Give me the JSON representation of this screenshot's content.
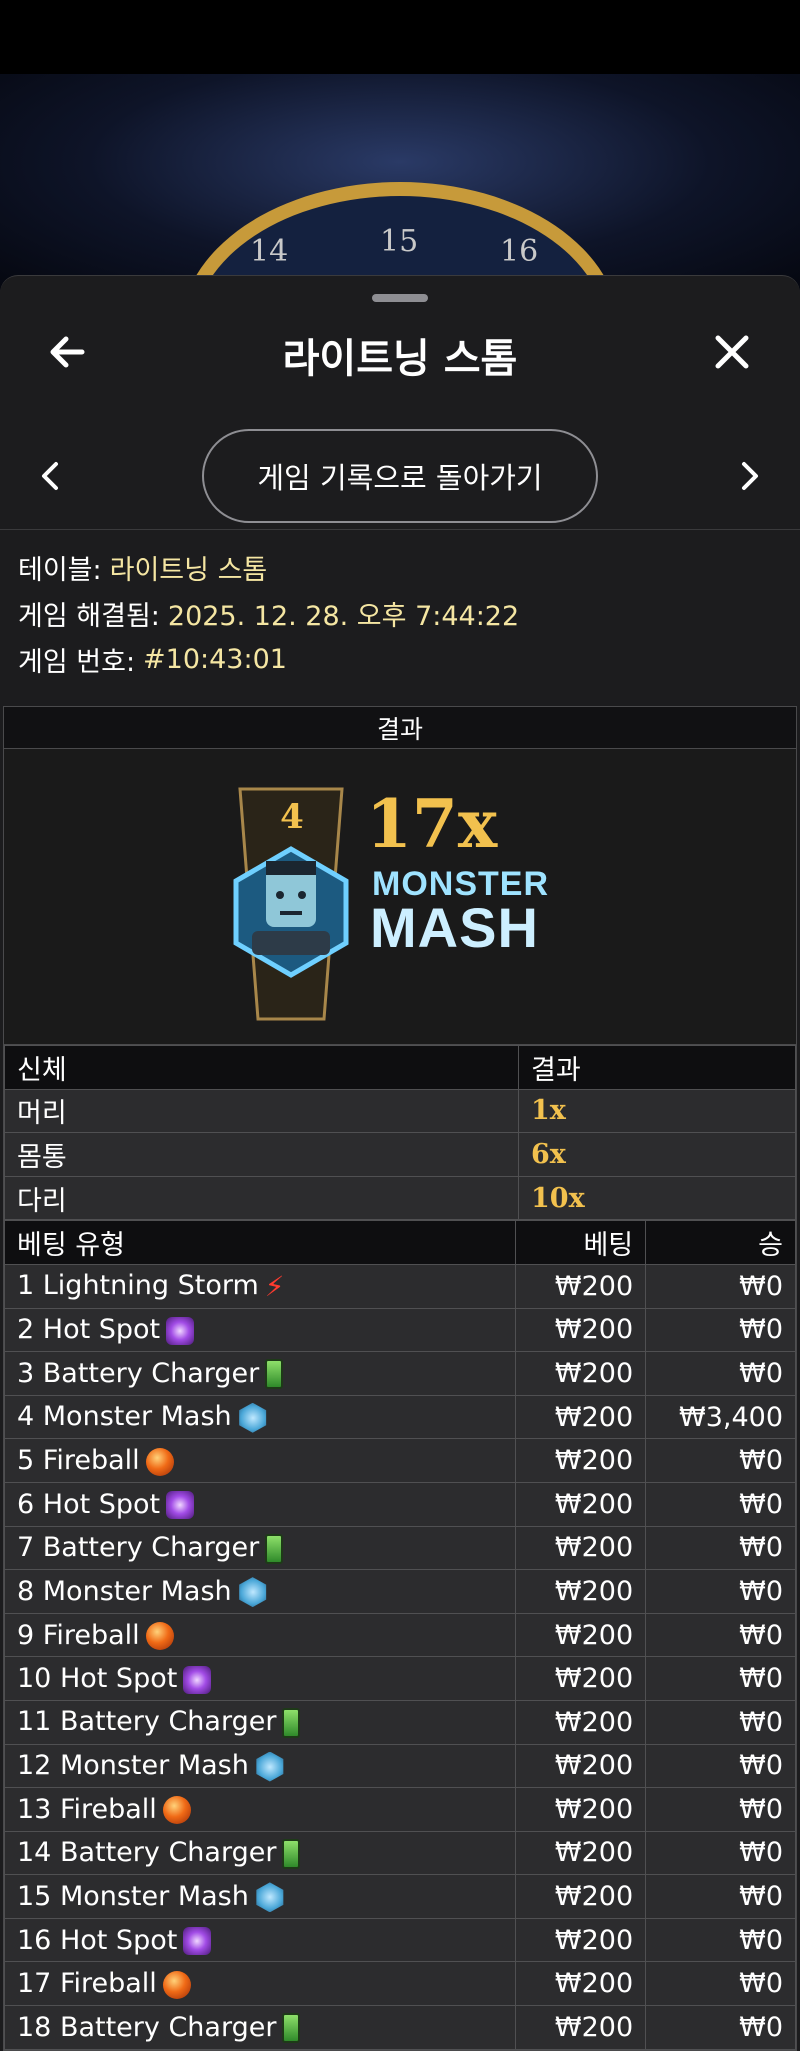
{
  "background": {
    "wheel_numbers": [
      "14",
      "15",
      "16"
    ]
  },
  "header": {
    "title": "라이트닝 스톰",
    "back_icon": "arrow-left-icon",
    "close_icon": "close-icon"
  },
  "navigation": {
    "back_to_history_label": "게임 기록으로 돌아가기",
    "prev_icon": "chevron-left-icon",
    "next_icon": "chevron-right-icon"
  },
  "info": {
    "table_label": "테이블:",
    "table_value": "라이트닝 스톰",
    "resolved_label": "게임 해결됨:",
    "resolved_value": "2025. 12. 28. 오후 7:44:22",
    "game_no_label": "게임 번호:",
    "game_no_value": "#10:43:01"
  },
  "result": {
    "header": "결과",
    "segment_number": "4",
    "multiplier": "17x",
    "name_line1": "MONSTER",
    "name_line2": "MASH"
  },
  "body_table": {
    "headers": [
      "신체",
      "결과"
    ],
    "rows": [
      {
        "part": "머리",
        "result": "1x"
      },
      {
        "part": "몸통",
        "result": "6x"
      },
      {
        "part": "다리",
        "result": "10x"
      }
    ]
  },
  "bets_table": {
    "headers": [
      "베팅 유형",
      "베팅",
      "승"
    ],
    "rows": [
      {
        "name": "1 Lightning Storm",
        "icon": "lightning-bolt-icon",
        "bet": "₩200",
        "win": "₩0"
      },
      {
        "name": "2 Hot Spot",
        "icon": "hot-spot-icon",
        "bet": "₩200",
        "win": "₩0"
      },
      {
        "name": "3 Battery Charger",
        "icon": "battery-icon",
        "bet": "₩200",
        "win": "₩0"
      },
      {
        "name": "4 Monster Mash",
        "icon": "monster-icon",
        "bet": "₩200",
        "win": "₩3,400"
      },
      {
        "name": "5 Fireball",
        "icon": "fireball-icon",
        "bet": "₩200",
        "win": "₩0"
      },
      {
        "name": "6 Hot Spot",
        "icon": "hot-spot-icon",
        "bet": "₩200",
        "win": "₩0"
      },
      {
        "name": "7 Battery Charger",
        "icon": "battery-icon",
        "bet": "₩200",
        "win": "₩0"
      },
      {
        "name": "8 Monster Mash",
        "icon": "monster-icon",
        "bet": "₩200",
        "win": "₩0"
      },
      {
        "name": "9 Fireball",
        "icon": "fireball-icon",
        "bet": "₩200",
        "win": "₩0"
      },
      {
        "name": "10 Hot Spot",
        "icon": "hot-spot-icon",
        "bet": "₩200",
        "win": "₩0"
      },
      {
        "name": "11 Battery Charger",
        "icon": "battery-icon",
        "bet": "₩200",
        "win": "₩0"
      },
      {
        "name": "12 Monster Mash",
        "icon": "monster-icon",
        "bet": "₩200",
        "win": "₩0"
      },
      {
        "name": "13 Fireball",
        "icon": "fireball-icon",
        "bet": "₩200",
        "win": "₩0"
      },
      {
        "name": "14 Battery Charger",
        "icon": "battery-icon",
        "bet": "₩200",
        "win": "₩0"
      },
      {
        "name": "15 Monster Mash",
        "icon": "monster-icon",
        "bet": "₩200",
        "win": "₩0"
      },
      {
        "name": "16 Hot Spot",
        "icon": "hot-spot-icon",
        "bet": "₩200",
        "win": "₩0"
      },
      {
        "name": "17 Fireball",
        "icon": "fireball-icon",
        "bet": "₩200",
        "win": "₩0"
      },
      {
        "name": "18 Battery Charger",
        "icon": "battery-icon",
        "bet": "₩200",
        "win": "₩0"
      }
    ]
  },
  "colors": {
    "sheet_bg": "#1c1c1e",
    "info_value": "#f5e6a3",
    "multiplier_gold": "#f2c14e"
  }
}
